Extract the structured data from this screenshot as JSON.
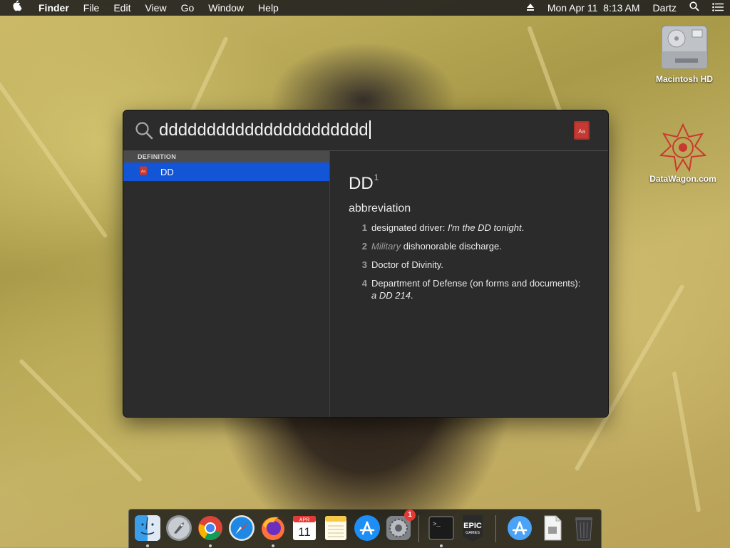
{
  "menubar": {
    "app": "Finder",
    "menus": [
      "File",
      "Edit",
      "View",
      "Go",
      "Window",
      "Help"
    ],
    "datetime": "Mon Apr 11  8:13 AM",
    "user": "Dartz"
  },
  "desktop": {
    "icons": [
      {
        "label": "Macintosh HD"
      },
      {
        "label": "DataWagon.com"
      }
    ]
  },
  "spotlight": {
    "query": "dddddddddddddddddddddd",
    "category": "DEFINITION",
    "result": {
      "label": "DD"
    },
    "definition": {
      "word": "DD",
      "superscript": "1",
      "part_of_speech": "abbreviation",
      "senses": [
        {
          "num": "1",
          "text": "designated driver: ",
          "example": "I'm the DD tonight",
          "tail": "."
        },
        {
          "num": "2",
          "label": "Military",
          "text": " dishonorable discharge."
        },
        {
          "num": "3",
          "text": "Doctor of Divinity."
        },
        {
          "num": "4",
          "text": "Department of Defense (on forms and documents): ",
          "example": "a DD 214",
          "tail": "."
        }
      ]
    }
  },
  "dock": {
    "apps": [
      {
        "icon": "finder-icon",
        "running": true
      },
      {
        "icon": "launchpad-icon"
      },
      {
        "icon": "chrome-icon",
        "running": true
      },
      {
        "icon": "safari-icon"
      },
      {
        "icon": "firefox-icon",
        "running": true
      },
      {
        "icon": "calendar-icon",
        "month": "APR",
        "day": "11"
      },
      {
        "icon": "notes-icon"
      },
      {
        "icon": "app-store-icon"
      },
      {
        "icon": "system-preferences-icon",
        "badge": "1"
      },
      {
        "icon": "terminal-icon",
        "running": true
      },
      {
        "icon": "epic-games-icon",
        "label_line1": "EPIC",
        "label_line2": "GAMES"
      },
      {
        "icon": "app-store-downloads-icon"
      },
      {
        "icon": "document-icon"
      },
      {
        "icon": "trash-icon"
      }
    ]
  }
}
